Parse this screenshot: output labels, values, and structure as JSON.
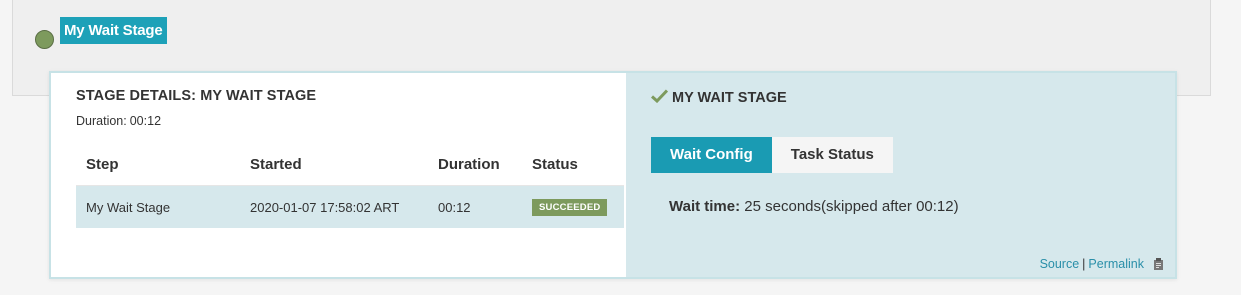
{
  "pipeline_stage": {
    "label": "My Wait Stage",
    "dot_color": "#7d9a5d",
    "label_bg": "#1da1b8"
  },
  "details": {
    "title": "STAGE DETAILS: MY WAIT STAGE",
    "duration_label": "Duration:",
    "duration_value": "00:12",
    "columns": [
      "Step",
      "Started",
      "Duration",
      "Status"
    ],
    "rows": [
      {
        "step": "My Wait Stage",
        "started": "2020-01-07 17:58:02 ART",
        "duration": "00:12",
        "status": "SUCCEEDED"
      }
    ]
  },
  "panel": {
    "icon": "check-icon",
    "title": "MY WAIT STAGE",
    "tabs": [
      "Wait Config",
      "Task Status"
    ],
    "active_tab": "Wait Config",
    "wait_time_label": "Wait time:",
    "wait_time_value": "25 seconds(skipped after 00:12)"
  },
  "footer": {
    "source_label": "Source",
    "separator": "|",
    "permalink_label": "Permalink",
    "copy_icon": "clipboard-icon"
  },
  "colors": {
    "accent": "#1a9bb3",
    "success": "#7d9a5d",
    "panel_bg": "#d6e8ec",
    "link": "#2a8fa9"
  }
}
